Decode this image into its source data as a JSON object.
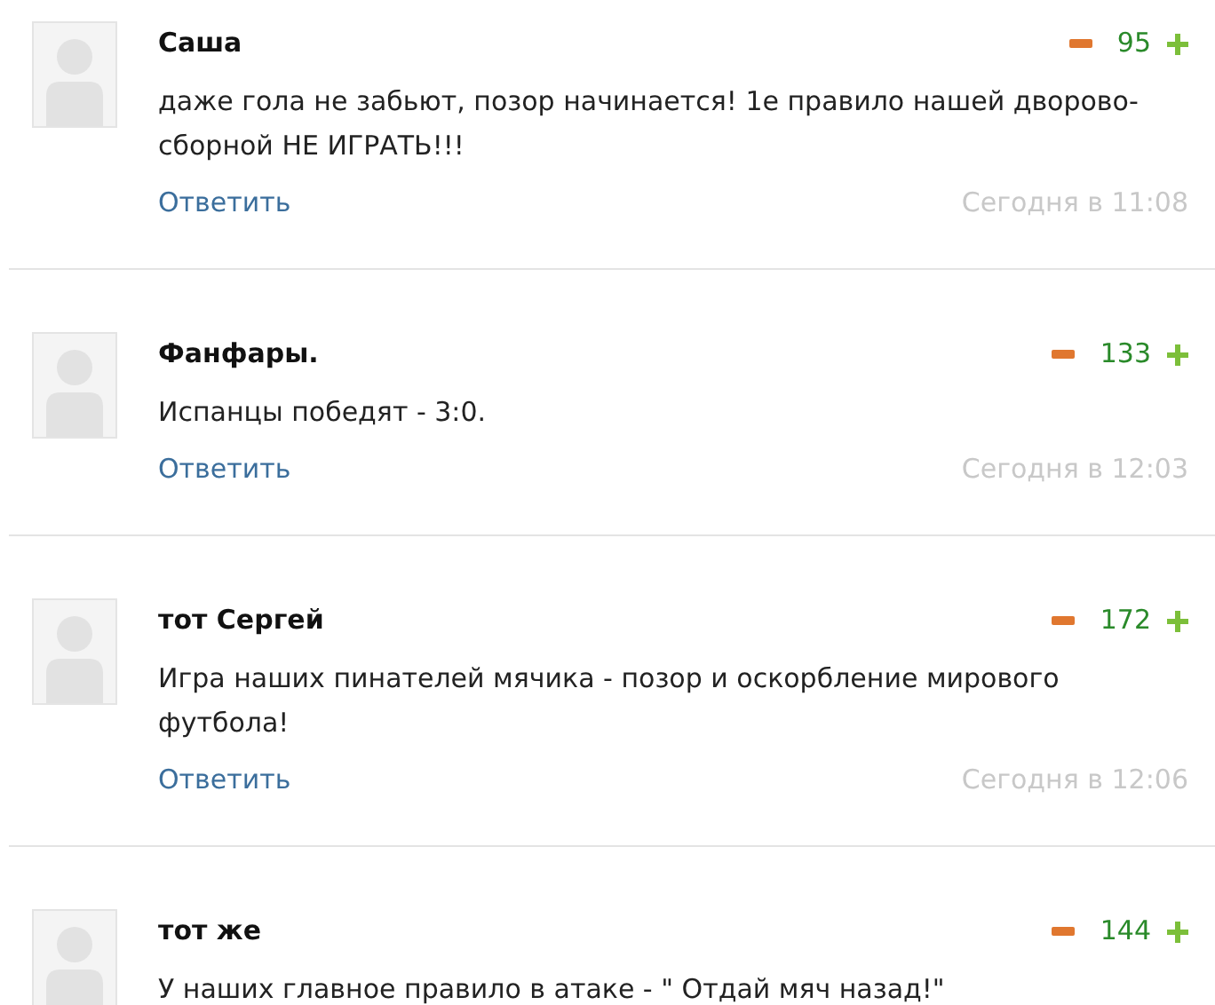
{
  "comments": [
    {
      "author": "Саша",
      "score": "95",
      "text": "даже гола не забьют, позор начинается! 1е правило нашей дворово-сборной НЕ ИГРАТЬ!!!",
      "reply": "Ответить",
      "time": "Сегодня в 11:08"
    },
    {
      "author": "Фанфары.",
      "score": "133",
      "text": "Испанцы победят - 3:0.",
      "reply": "Ответить",
      "time": "Сегодня в 12:03"
    },
    {
      "author": "тот Сергей",
      "score": "172",
      "text": "Игра наших пинателей мячика - позор и оскорбление мирового футбола!",
      "reply": "Ответить",
      "time": "Сегодня в 12:06"
    },
    {
      "author": "тот же",
      "score": "144",
      "text": "У наших главное правило в атаке - \" Отдай мяч назад!\""
    }
  ]
}
